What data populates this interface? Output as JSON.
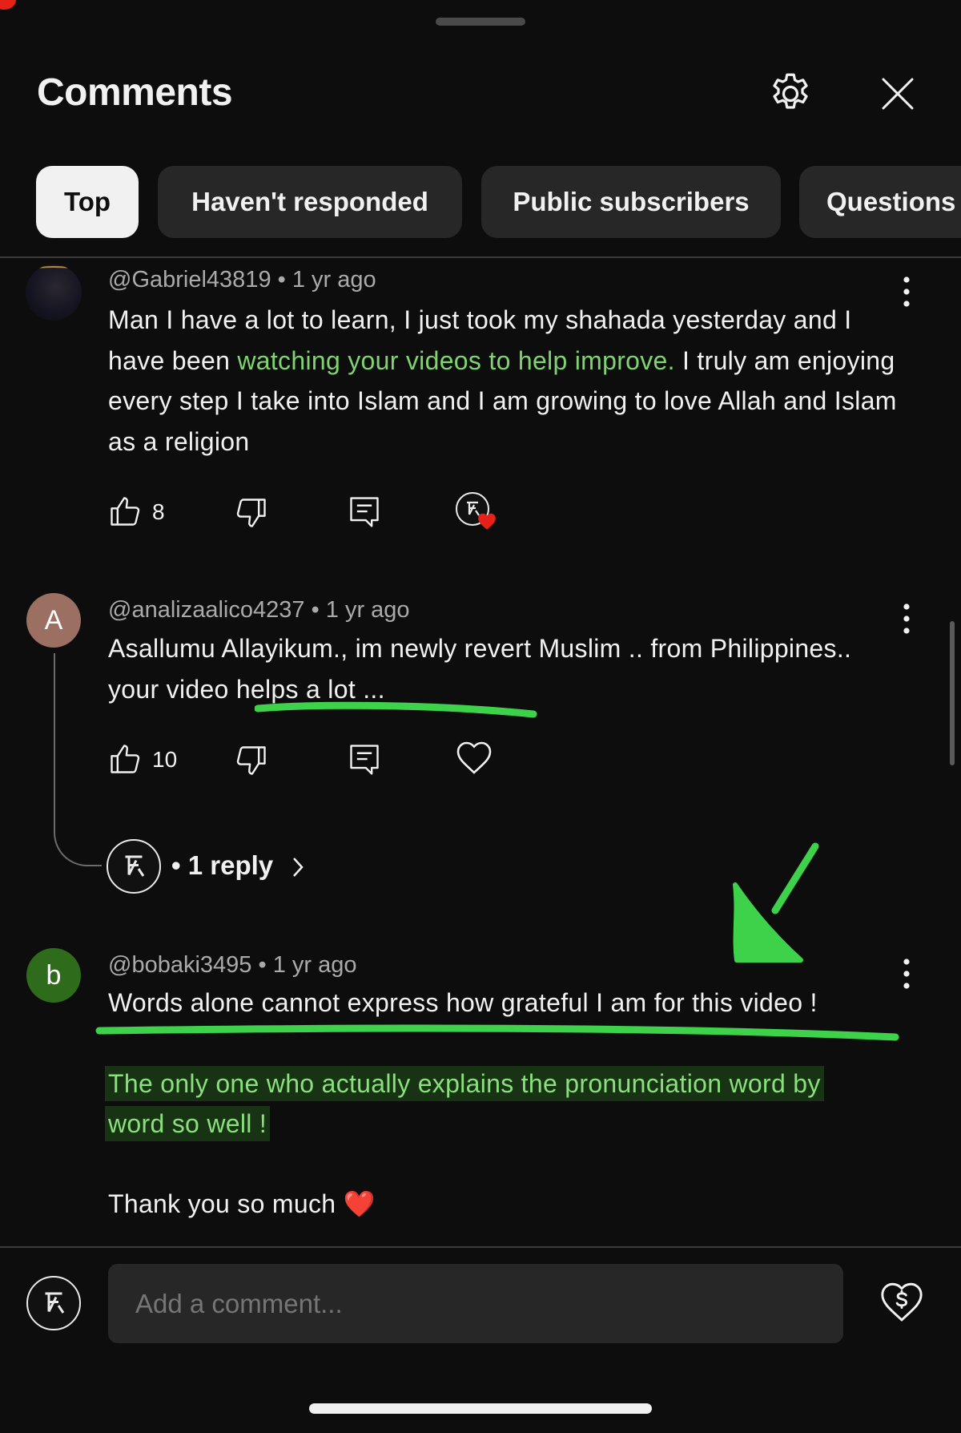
{
  "header": {
    "title": "Comments",
    "settings_icon": "gear-icon",
    "close_icon": "close-icon"
  },
  "filters": {
    "chips": [
      {
        "label": "Top",
        "active": true
      },
      {
        "label": "Haven't responded",
        "active": false
      },
      {
        "label": "Public subscribers",
        "active": false
      },
      {
        "label": "Questions",
        "active": false
      }
    ]
  },
  "comments": [
    {
      "author": "@Gabriel43819",
      "time": "• 1 yr ago",
      "text_1": "Man I have a lot to learn, I just took my shahada yesterday and I have been ",
      "text_highlight": "watching your videos to help improve.",
      "text_2": " I truly am enjoying every step I take into Islam and I am growing to love Allah and Islam as a religion",
      "likes": "8",
      "creator_heart": true
    },
    {
      "author": "@analizaalico4237",
      "avatar_letter": "A",
      "time": "• 1 yr ago",
      "text_1": "Asallumu Allayikum., im newly revert Muslim .. from Philippines.. ",
      "text_underlined": "your video helps a lot",
      "text_2": " ...",
      "likes": "10",
      "replies": "• 1 reply"
    },
    {
      "author": "@bobaki3495",
      "avatar_letter": "b",
      "time": "• 1 yr ago",
      "line_1": "Words alone cannot express how grateful I am for this video !",
      "highlight_1": "The only one who actually explains the pronunciation word by",
      "highlight_2": "word so well !",
      "line_3": "Thank you so much ❤️"
    }
  ],
  "composer": {
    "placeholder": "Add a comment...",
    "thanks_icon": "super-thanks-icon"
  },
  "colors": {
    "background": "#0d0d0d",
    "chip": "#272727",
    "active_chip": "#f1f1f1",
    "annotation_green": "#3ed24b",
    "heart_red": "#e62117"
  }
}
